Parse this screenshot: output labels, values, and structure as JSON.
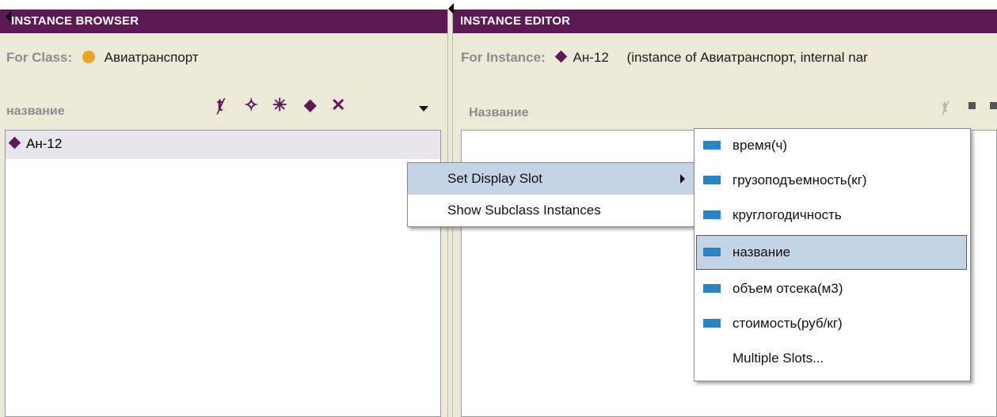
{
  "browser": {
    "title": "INSTANCE BROWSER",
    "for_label": "For Class:",
    "class_name": "Авиатранспорт",
    "slot_header": "название",
    "items": [
      {
        "label": "Ан-12"
      }
    ]
  },
  "editor": {
    "title": "INSTANCE EDITOR",
    "for_label": "For Instance:",
    "instance_name": "Ан-12",
    "instance_info": "(instance of Авиатранспорт, internal nar",
    "slot_header": "Название"
  },
  "context_menu": {
    "items": [
      {
        "label": "Set Display Slot"
      },
      {
        "label": "Show Subclass Instances"
      }
    ]
  },
  "submenu": {
    "items": [
      {
        "label": "время(ч)"
      },
      {
        "label": "грузоподъемность(кг)"
      },
      {
        "label": "круглогодичность"
      },
      {
        "label": "название"
      },
      {
        "label": "объем отсека(м3)"
      },
      {
        "label": "стоимость(руб/кг)"
      },
      {
        "label": "Multiple Slots..."
      }
    ],
    "selected": "название"
  },
  "colors": {
    "titlebar": "#5c1a55",
    "slot_icon": "#2b83c2",
    "menu_highlight": "#c5d3e6",
    "class_dot": "#e6a623"
  }
}
